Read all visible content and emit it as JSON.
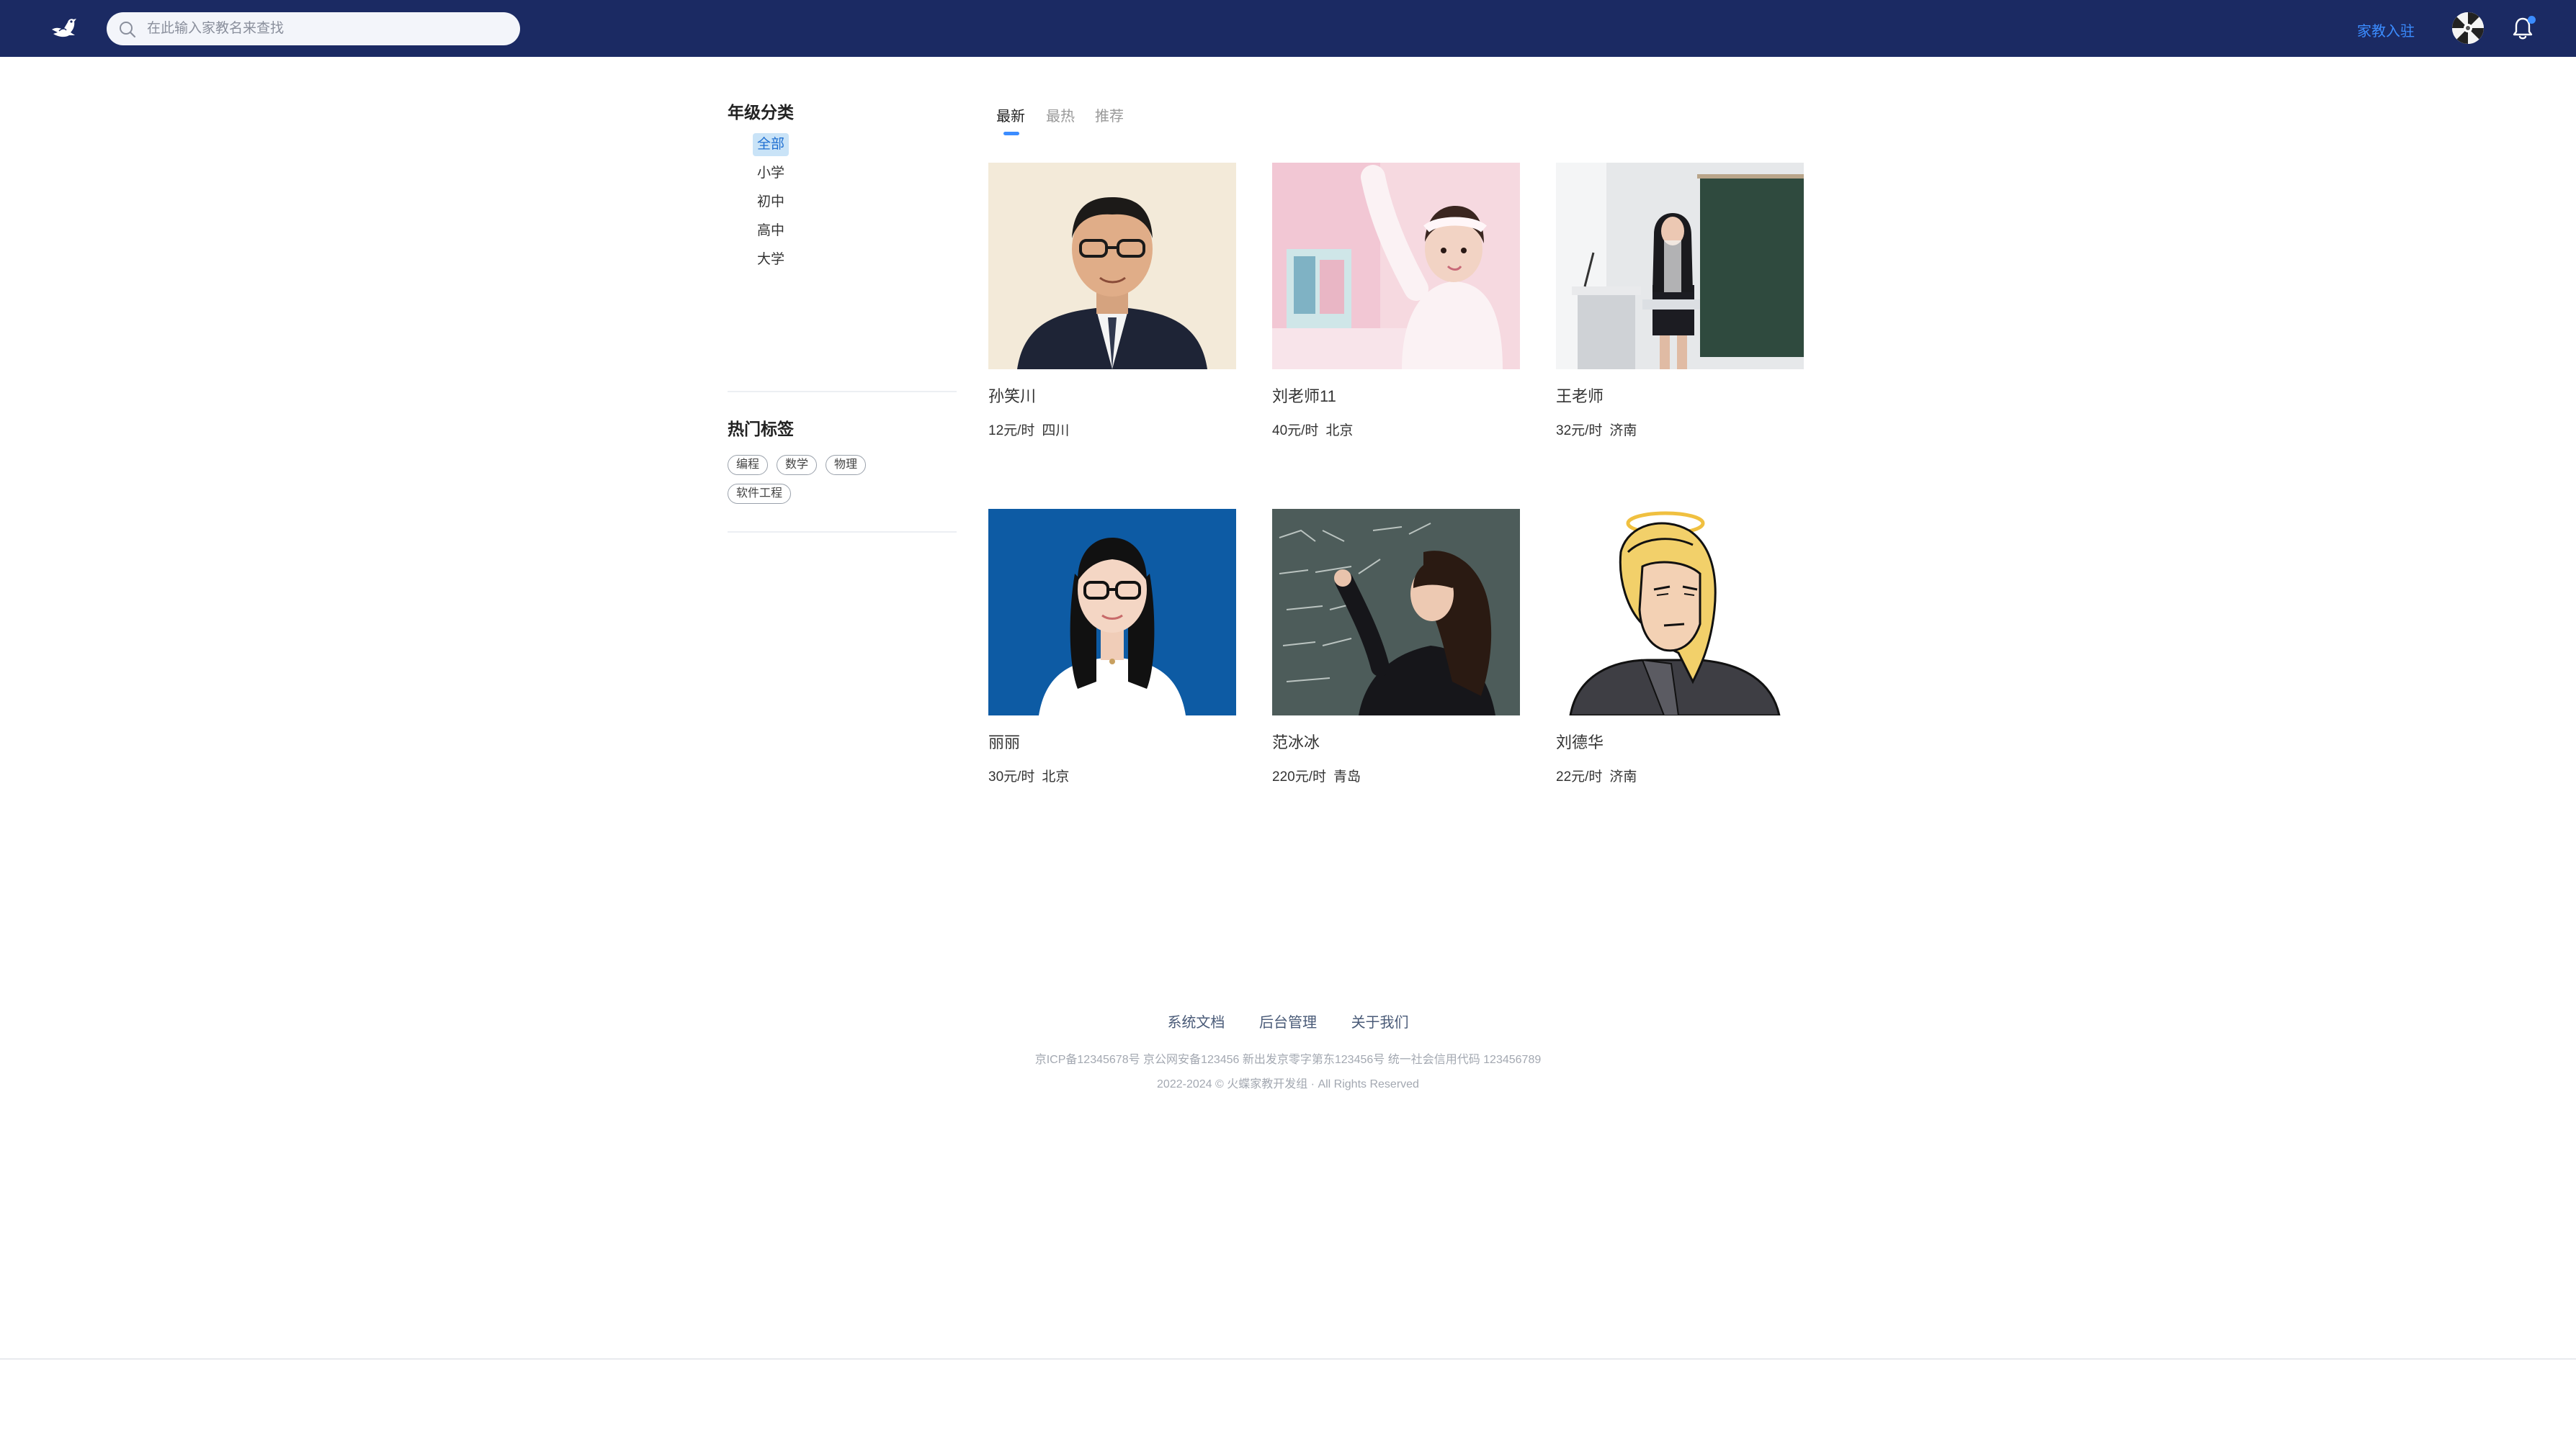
{
  "header": {
    "search_placeholder": "在此输入家教名来查找",
    "join_label": "家教入驻",
    "logo_icon": "dove-logo-icon",
    "avatar_icon": "user-avatar",
    "bell_icon": "bell-icon",
    "accent_color": "#3b8cff",
    "bar_color": "#1b2a63"
  },
  "sidebar": {
    "grade_title": "年级分类",
    "grades": [
      "全部",
      "小学",
      "初中",
      "高中",
      "大学"
    ],
    "selected_grade": "全部",
    "tags_title": "热门标签",
    "tags": [
      "编程",
      "数学",
      "物理",
      "软件工程"
    ]
  },
  "tabs": [
    "最新",
    "最热",
    "推荐"
  ],
  "active_tab": "最新",
  "tutors": [
    {
      "name": "孙笑川",
      "price": "12元/时",
      "city": "四川"
    },
    {
      "name": "刘老师11",
      "price": "40元/时",
      "city": "北京"
    },
    {
      "name": "王老师",
      "price": "32元/时",
      "city": "济南"
    },
    {
      "name": "丽丽",
      "price": "30元/时",
      "city": "北京"
    },
    {
      "name": "范冰冰",
      "price": "220元/时",
      "city": "青岛"
    },
    {
      "name": "刘德华",
      "price": "22元/时",
      "city": "济南"
    }
  ],
  "footer": {
    "links": [
      "系统文档",
      "后台管理",
      "关于我们"
    ],
    "icp": "京ICP备12345678号  京公网安备123456  新出发京零字第东123456号  统一社会信用代码 123456789",
    "copyright": "2022-2024 © 火蝶家教开发组 · All Rights Reserved"
  }
}
